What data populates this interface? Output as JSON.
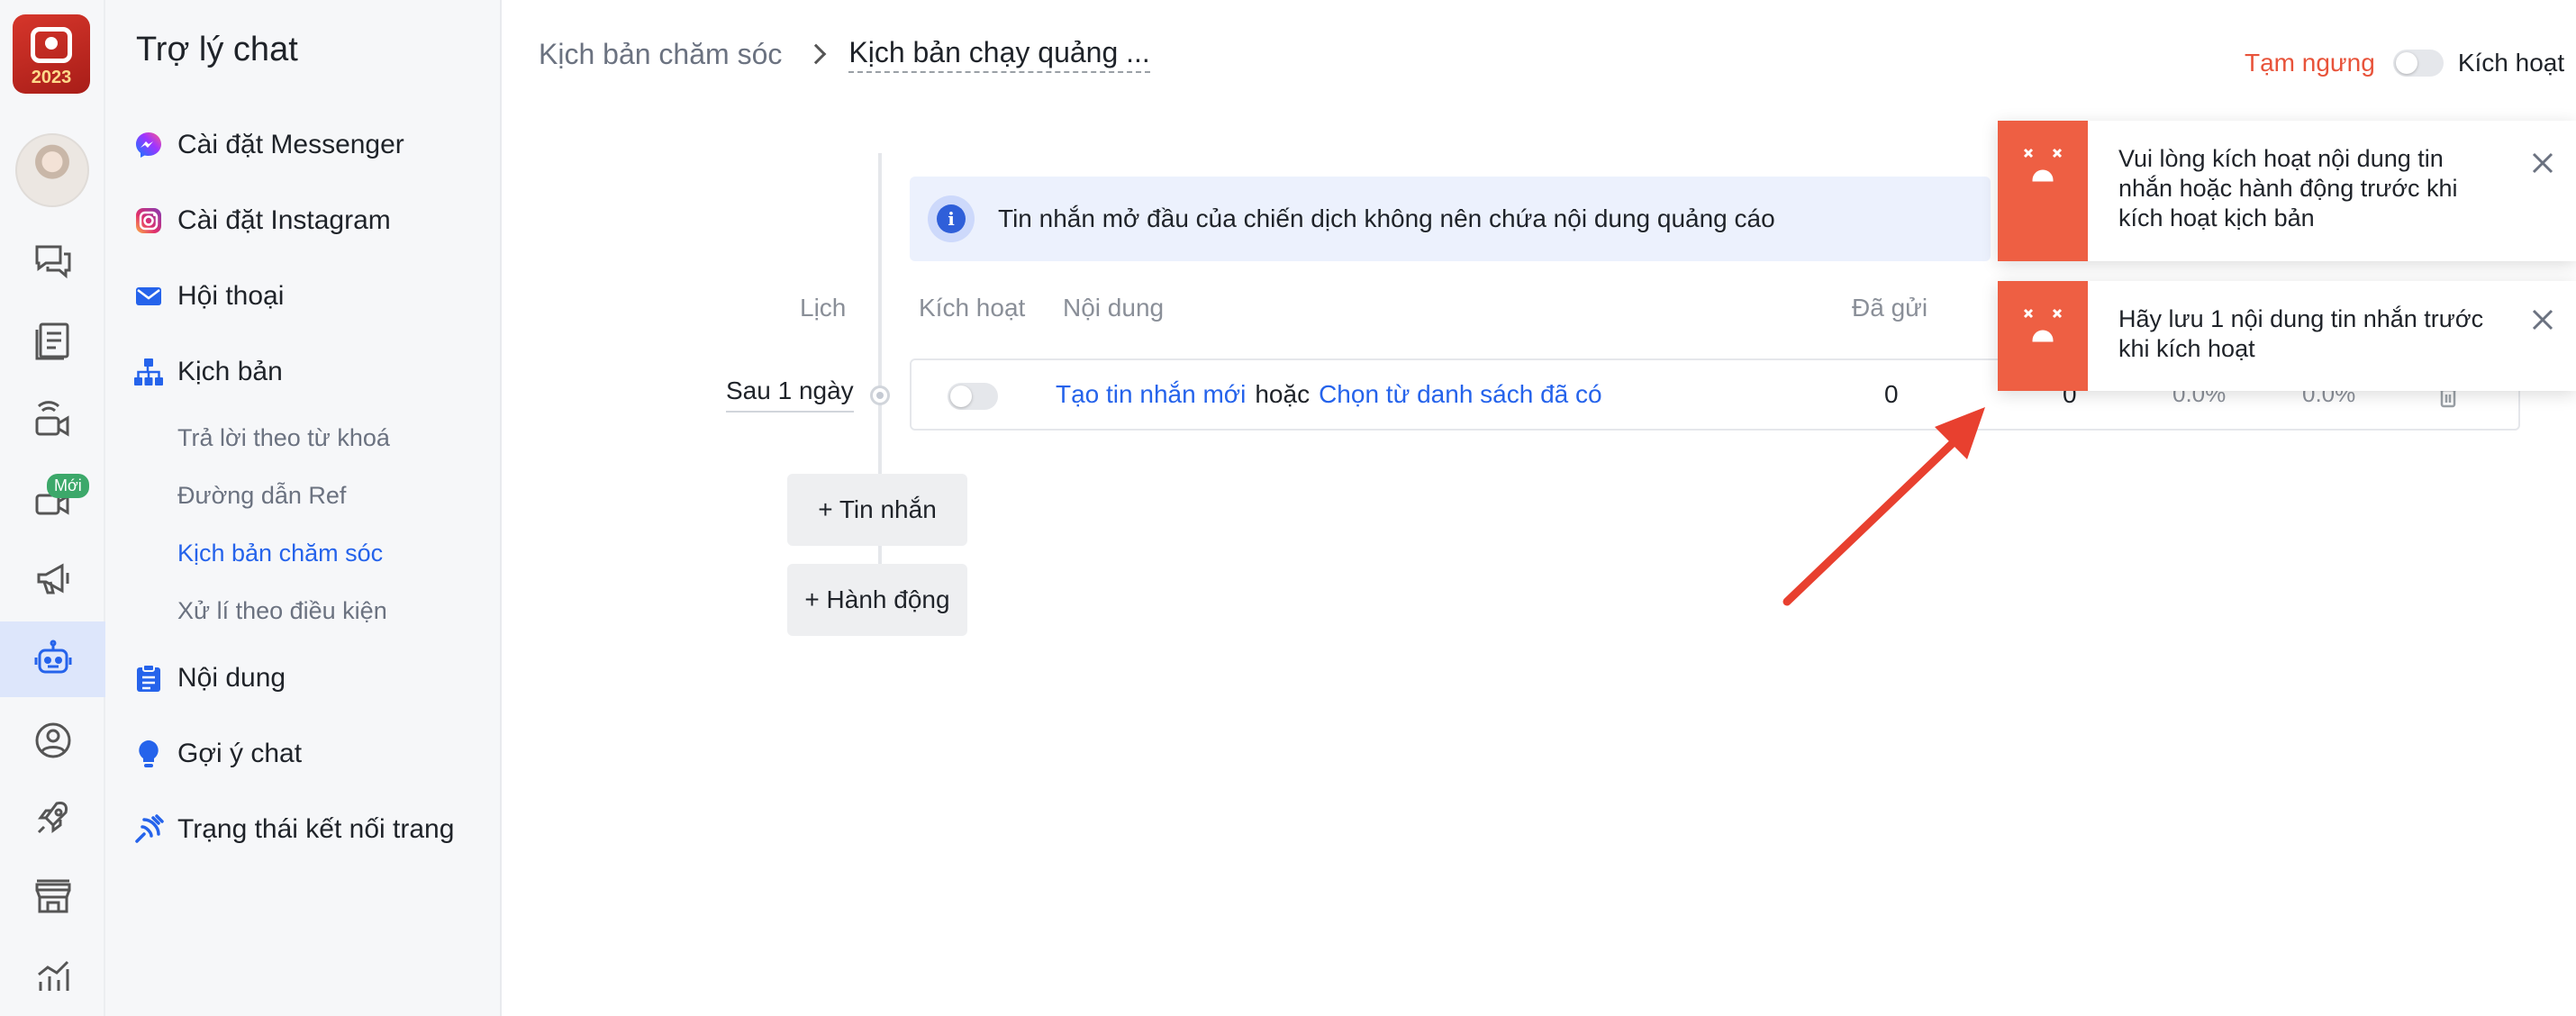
{
  "app": {
    "logo_year": "2023"
  },
  "rail": {
    "new_badge": "Mới"
  },
  "sidebar": {
    "title": "Trợ lý chat",
    "items": [
      {
        "label": "Cài đặt Messenger",
        "icon": "messenger-icon"
      },
      {
        "label": "Cài đặt Instagram",
        "icon": "instagram-icon"
      },
      {
        "label": "Hội thoại",
        "icon": "mail-icon"
      },
      {
        "label": "Kịch bản",
        "icon": "sitemap-icon"
      },
      {
        "label": "Nội dung",
        "icon": "clipboard-icon"
      },
      {
        "label": "Gợi ý chat",
        "icon": "lightbulb-icon"
      },
      {
        "label": "Trạng thái kết nối trang",
        "icon": "connection-icon"
      }
    ],
    "sub_items": [
      {
        "label": "Trả lời theo từ khoá"
      },
      {
        "label": "Đường dẫn Ref"
      },
      {
        "label": "Kịch bản chăm sóc",
        "active": true
      },
      {
        "label": "Xử lí theo điều kiện"
      }
    ]
  },
  "header": {
    "breadcrumb_parent": "Kịch bản chăm sóc",
    "breadcrumb_current": "Kịch bản chạy quảng ...",
    "status_paused": "Tạm ngưng",
    "status_active": "Kích hoạt"
  },
  "main": {
    "info_text": "Tin nhắn mở đầu của chiến dịch không nên chứa nội dung quảng cáo",
    "columns": {
      "schedule": "Lịch",
      "activate": "Kích hoạt",
      "content": "Nội dung",
      "sent": "Đã gửi"
    },
    "row": {
      "schedule": "Sau 1 ngày",
      "create_link": "Tạo tin nhắn mới",
      "or_text": "hoặc",
      "choose_link": "Chọn từ danh sách đã có",
      "sent": "0",
      "second_count": "0",
      "pct1": "0.0%",
      "pct2": "0.0%"
    },
    "add_message": "+ Tin nhắn",
    "add_action": "+ Hành động"
  },
  "toasts": [
    {
      "text": "Vui lòng kích hoạt nội dung tin nhắn hoặc hành động trước khi kích hoạt kịch bản"
    },
    {
      "text": "Hãy lưu 1 nội dung tin nhắn trước khi kích hoạt"
    }
  ],
  "colors": {
    "accent": "#2563eb",
    "toast_error": "#ee5f43",
    "paused": "#e8533a",
    "arrow": "#e8402f"
  }
}
